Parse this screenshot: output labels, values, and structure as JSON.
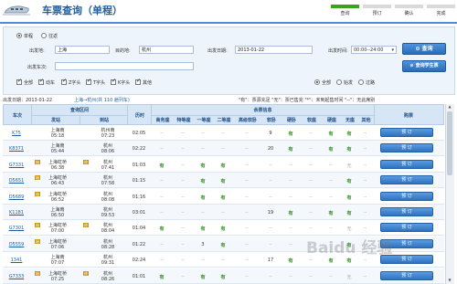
{
  "header": {
    "title": "车票查询（单程）",
    "steps": [
      "查询",
      "预订",
      "确认",
      "完成"
    ],
    "active_step": 0
  },
  "query": {
    "trip_single": "单程",
    "trip_return": "往返",
    "from_label": "出发地:",
    "from_value": "上海",
    "to_label": "目的地:",
    "to_value": "杭州",
    "date_label": "出发日期:",
    "date_value": "2013-01-22",
    "time_label": "出发时间:",
    "time_value": "00:00--24:00",
    "train_no_label": "出发车次:",
    "train_no_value": "",
    "search_button": "查询",
    "student_button": "查询学生票",
    "types": [
      "全部",
      "动车",
      "Z字头",
      "T字头",
      "K字头",
      "其他"
    ],
    "station_filters": [
      "全部",
      "始发",
      "过路"
    ]
  },
  "info": {
    "date": "出发日期：2013-01-22",
    "route": "上海→杭州(共 110 趟列车)",
    "legend": "\"有\"：票源充足   \"无\"：票已售完   \"*\"：未到起售时间   \"--\"：无此席别"
  },
  "table": {
    "headers": {
      "train": "车次",
      "section": "查询区间",
      "from": "发站",
      "to": "到站",
      "duration": "历时",
      "remaining": "余票信息",
      "booking": "购票"
    },
    "seat_columns": [
      "商务座",
      "特等座",
      "一等座",
      "二等座",
      "高级软卧",
      "软卧",
      "硬卧",
      "软座",
      "硬座",
      "无座",
      "其他"
    ],
    "book_label": "预  订",
    "rows": [
      {
        "train": "K75",
        "from": "上海南",
        "dep": "05:18",
        "to": "杭州南",
        "arr": "07:23",
        "dur": "02:05",
        "seats": [
          "--",
          "--",
          "--",
          "--",
          "--",
          "9",
          "有",
          "--",
          "有",
          "有",
          "--"
        ],
        "fb": "",
        "tb": ""
      },
      {
        "train": "K8371",
        "from": "上海南",
        "dep": "05:44",
        "to": "杭州",
        "arr": "08:06",
        "dur": "02:22",
        "seats": [
          "--",
          "--",
          "--",
          "--",
          "--",
          "20",
          "有",
          "--",
          "有",
          "有",
          "--"
        ],
        "fb": "",
        "tb": ""
      },
      {
        "train": "G7331",
        "from": "上海虹桥",
        "dep": "06:38",
        "to": "杭州",
        "arr": "07:41",
        "dur": "01:03",
        "seats": [
          "有",
          "--",
          "有",
          "有",
          "--",
          "--",
          "--",
          "--",
          "--",
          "无",
          "--"
        ],
        "fb": "始",
        "tb": "终"
      },
      {
        "train": "D5651",
        "from": "上海虹桥",
        "dep": "06:43",
        "to": "杭州",
        "arr": "07:58",
        "dur": "01:15",
        "seats": [
          "--",
          "--",
          "有",
          "有",
          "--",
          "--",
          "--",
          "--",
          "--",
          "有",
          "--"
        ],
        "fb": "始",
        "tb": ""
      },
      {
        "train": "D5689",
        "from": "上海虹桥",
        "dep": "06:52",
        "to": "杭州",
        "arr": "08:08",
        "dur": "01:16",
        "seats": [
          "--",
          "--",
          "有",
          "有",
          "--",
          "--",
          "--",
          "--",
          "--",
          "有",
          "--"
        ],
        "fb": "始",
        "tb": ""
      },
      {
        "train": "K1181",
        "from": "上海南",
        "dep": "06:50",
        "to": "杭州",
        "arr": "09:53",
        "dur": "03:01",
        "seats": [
          "--",
          "--",
          "--",
          "--",
          "--",
          "19",
          "有",
          "--",
          "有",
          "有",
          "--"
        ],
        "fb": "",
        "tb": ""
      },
      {
        "train": "G7301",
        "from": "上海虹桥",
        "dep": "07:00",
        "to": "杭州",
        "arr": "08:04",
        "dur": "01:04",
        "seats": [
          "有",
          "--",
          "有",
          "有",
          "--",
          "--",
          "--",
          "--",
          "--",
          "无",
          "--"
        ],
        "fb": "始",
        "tb": "终"
      },
      {
        "train": "D5559",
        "from": "上海虹桥",
        "dep": "07:06",
        "to": "杭州",
        "arr": "08:28",
        "dur": "01:22",
        "seats": [
          "--",
          "--",
          "3",
          "有",
          "--",
          "--",
          "--",
          "--",
          "--",
          "有",
          "--"
        ],
        "fb": "始",
        "tb": ""
      },
      {
        "train": "1341",
        "from": "上海南",
        "dep": "07:07",
        "to": "杭州",
        "arr": "09:31",
        "dur": "02:24",
        "seats": [
          "--",
          "--",
          "--",
          "--",
          "--",
          "17",
          "有",
          "--",
          "有",
          "有",
          "--"
        ],
        "fb": "",
        "tb": ""
      },
      {
        "train": "G7333",
        "from": "上海虹桥",
        "dep": "07:25",
        "to": "杭州",
        "arr": "08:26",
        "dur": "01:01",
        "seats": [
          "有",
          "--",
          "有",
          "有",
          "--",
          "--",
          "--",
          "--",
          "--",
          "无",
          "--"
        ],
        "fb": "始",
        "tb": "终"
      }
    ]
  },
  "watermark": "Baidu 经验",
  "colors": {
    "accent": "#2a6cb8",
    "available": "#2e8b1e",
    "header_bg": "#d6e6f7",
    "step_active": "#3aa21c"
  }
}
